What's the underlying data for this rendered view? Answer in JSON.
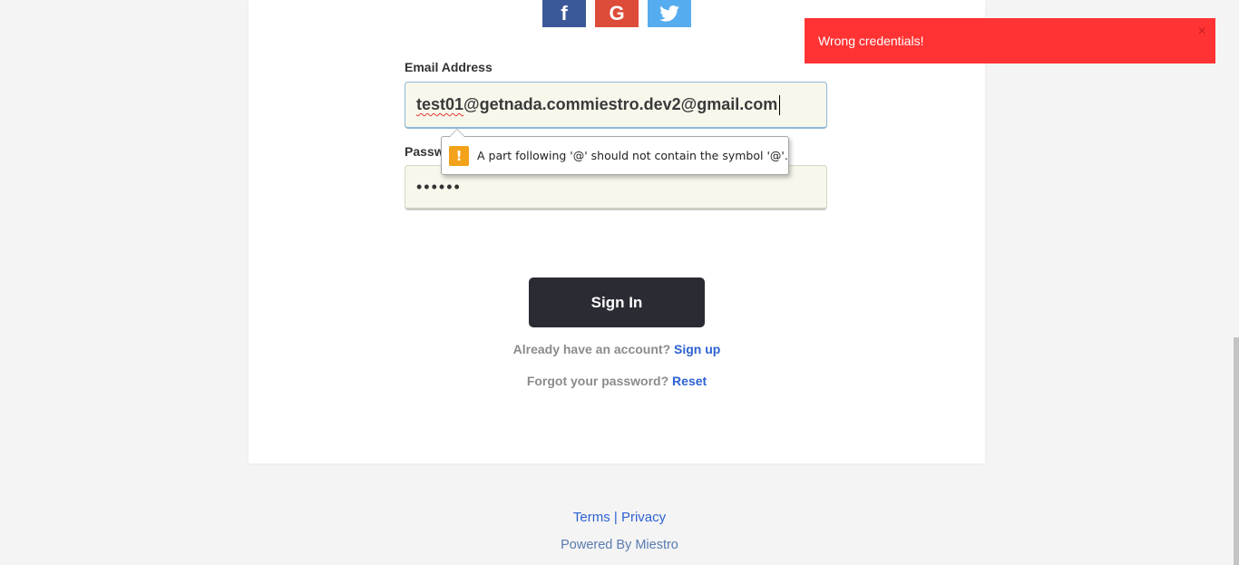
{
  "social": {
    "facebook_glyph": "f",
    "google_glyph": "G",
    "twitter_glyph": "🐦"
  },
  "form": {
    "email_label": "Email Address",
    "email_value": "test01@getnada.commiestro.dev2@gmail.com",
    "email_value_prefix": "test01",
    "email_value_rest": "@getnada.commiestro.dev2@gmail.com",
    "password_label": "Password",
    "password_value": "••••••",
    "validation_message": "A part following '@' should not contain the symbol '@'.",
    "warning_glyph": "!",
    "signin_label": "Sign In"
  },
  "links": {
    "have_account_text": "Already have an account?",
    "signup_label": "Sign up",
    "forgot_text": "Forgot your password?",
    "reset_label": "Reset"
  },
  "footer": {
    "terms_label": "Terms",
    "separator": "|",
    "privacy_label": "Privacy",
    "powered_by": "Powered By Miestro"
  },
  "toast": {
    "message": "Wrong credentials!",
    "close_glyph": "×"
  },
  "colors": {
    "facebook": "#3b5998",
    "google": "#dd4b39",
    "twitter": "#55acee",
    "toast_bg": "#ff3333",
    "button_bg": "#2a2b33",
    "link": "#2d62d2"
  }
}
